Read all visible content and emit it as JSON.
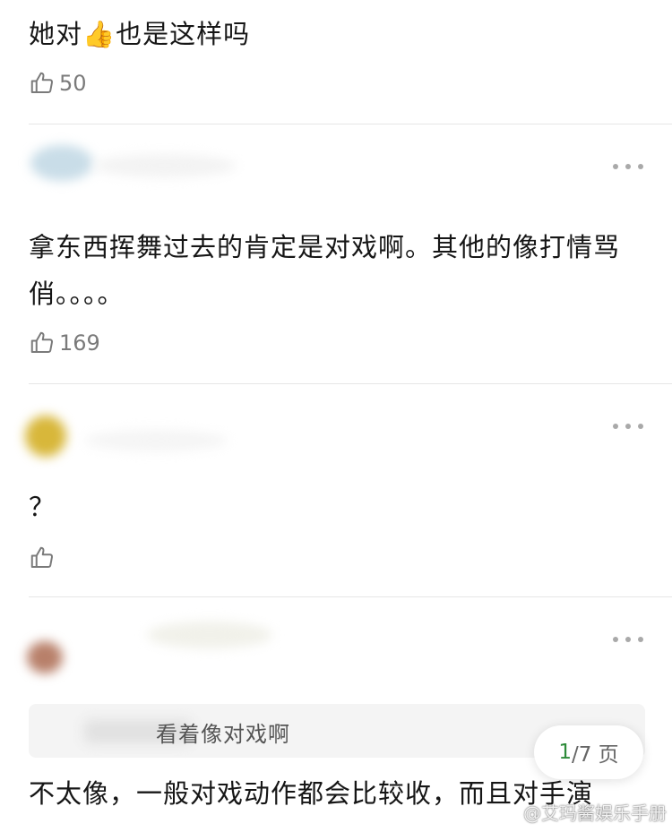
{
  "comments": [
    {
      "text": "她对👍也是这样吗",
      "likes": "50"
    },
    {
      "text": "拿东西挥舞过去的肯定是对戏啊。其他的像打情骂俏。。。。",
      "likes": "169"
    },
    {
      "text": "？",
      "likes": ""
    },
    {
      "quote": "看着像对戏啊",
      "text": "不太像，一般对戏动作都会比较收，而且对手演"
    }
  ],
  "pager": {
    "current": "1",
    "separator": "/7 页"
  },
  "watermark": "@艾玛酱娱乐手册",
  "icons": {
    "like": "thumbs-up-icon",
    "more": "more-dots-icon",
    "weibo": "weibo-logo-icon"
  }
}
